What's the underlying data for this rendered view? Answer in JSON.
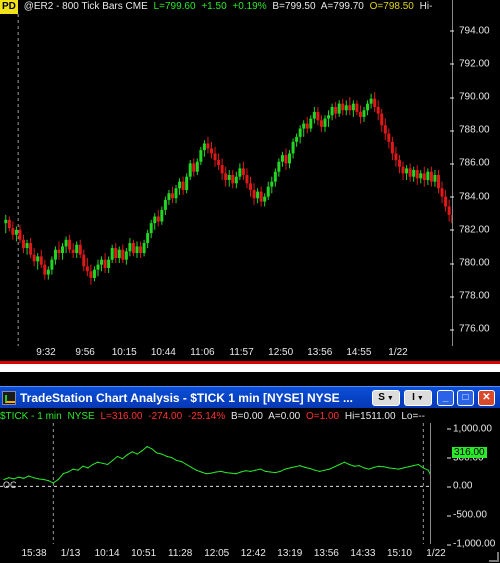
{
  "upper_chart": {
    "badge": "PD",
    "symbol_line": "@ER2 - 800 Tick Bars CME",
    "last": "L=799.60",
    "change": "+1.50",
    "pct_change": "+0.19%",
    "bid": "B=799.50",
    "ask": "A=799.70",
    "open": "O=798.50",
    "high": "Hi-",
    "colors": {
      "up_bar": "#23d623",
      "down_bar": "#e01818",
      "session_line": "#9a9a9a"
    }
  },
  "lower_window": {
    "title": "TradeStation Chart Analysis - $TICK 1 min [NYSE] NYSE ...",
    "symbol": "$TICK - 1 min",
    "exchange": "NYSE",
    "last": "L=316.00",
    "change": "-274.00",
    "pct_change": "-25.14%",
    "bid": "B=0.00",
    "ask": "A=0.00",
    "open": "O=1.00",
    "high": "Hi=1511.00",
    "low": "Lo=--",
    "last_value_marker": "316.00",
    "loc_label": "OC",
    "buttons": {
      "dropdown1": "S",
      "dropdown2": "I",
      "minimize": "_",
      "maximize": "□",
      "close": "✕"
    },
    "colors": {
      "line": "#2be82b",
      "zero_line": "#e0e0e0",
      "titlebar": "#0a4fd8"
    }
  },
  "chart_data": [
    {
      "type": "bar",
      "subtype": "ohlc",
      "title": "@ER2 - 800 Tick Bars CME",
      "xlabel": "",
      "ylabel": "",
      "ylim": [
        775,
        795
      ],
      "yticks": [
        "794.00",
        "792.00",
        "790.00",
        "788.00",
        "786.00",
        "784.00",
        "782.00",
        "780.00",
        "778.00",
        "776.00"
      ],
      "xticks": [
        "9:32",
        "9:56",
        "10:15",
        "10:44",
        "11:06",
        "11:57",
        "12:50",
        "13:56",
        "14:55",
        "1/22"
      ],
      "grid": false,
      "session_breaks": [
        4,
        127
      ],
      "bars": [
        [
          782.4,
          782.9,
          781.8,
          782.6
        ],
        [
          782.6,
          782.8,
          781.9,
          782.1
        ],
        [
          782.1,
          782.5,
          781.4,
          781.7
        ],
        [
          781.7,
          782.2,
          781.3,
          782.0
        ],
        [
          782.0,
          782.3,
          781.2,
          781.4
        ],
        [
          781.4,
          781.7,
          780.6,
          780.9
        ],
        [
          780.9,
          781.4,
          780.5,
          781.2
        ],
        [
          781.2,
          781.5,
          780.3,
          780.5
        ],
        [
          780.5,
          780.9,
          779.8,
          780.1
        ],
        [
          780.1,
          780.6,
          779.6,
          780.4
        ],
        [
          780.4,
          780.8,
          779.7,
          779.9
        ],
        [
          779.9,
          780.2,
          779.0,
          779.3
        ],
        [
          779.3,
          779.8,
          779.0,
          779.6
        ],
        [
          779.6,
          780.4,
          779.3,
          780.2
        ],
        [
          780.2,
          781.0,
          779.9,
          780.8
        ],
        [
          780.8,
          781.3,
          780.2,
          780.6
        ],
        [
          780.6,
          781.2,
          780.2,
          781.0
        ],
        [
          781.0,
          781.6,
          780.6,
          781.4
        ],
        [
          781.4,
          781.7,
          780.6,
          780.8
        ],
        [
          780.8,
          781.2,
          780.3,
          780.6
        ],
        [
          780.6,
          781.3,
          780.3,
          781.1
        ],
        [
          781.1,
          781.4,
          780.3,
          780.5
        ],
        [
          780.5,
          780.8,
          779.5,
          779.8
        ],
        [
          779.8,
          780.3,
          779.2,
          779.5
        ],
        [
          779.5,
          779.9,
          778.7,
          779.1
        ],
        [
          779.1,
          779.8,
          778.9,
          779.6
        ],
        [
          779.6,
          780.2,
          779.2,
          779.9
        ],
        [
          779.9,
          780.4,
          779.5,
          780.2
        ],
        [
          780.2,
          780.6,
          779.4,
          779.7
        ],
        [
          779.7,
          780.4,
          779.4,
          780.2
        ],
        [
          780.2,
          781.1,
          780.0,
          780.9
        ],
        [
          780.9,
          781.2,
          780.0,
          780.3
        ],
        [
          780.3,
          781.0,
          780.0,
          780.8
        ],
        [
          780.8,
          781.1,
          780.0,
          780.2
        ],
        [
          780.2,
          780.9,
          779.9,
          780.7
        ],
        [
          780.7,
          781.5,
          780.4,
          781.2
        ],
        [
          781.2,
          781.4,
          780.4,
          780.6
        ],
        [
          780.6,
          781.3,
          780.3,
          781.0
        ],
        [
          781.0,
          781.3,
          780.3,
          780.6
        ],
        [
          780.6,
          781.4,
          780.4,
          781.2
        ],
        [
          781.2,
          782.0,
          780.9,
          781.8
        ],
        [
          781.8,
          782.6,
          781.5,
          782.4
        ],
        [
          782.4,
          783.0,
          782.0,
          782.8
        ],
        [
          782.8,
          783.2,
          782.2,
          782.5
        ],
        [
          782.5,
          783.4,
          782.3,
          783.2
        ],
        [
          783.2,
          784.0,
          782.9,
          783.8
        ],
        [
          783.8,
          784.4,
          783.5,
          784.2
        ],
        [
          784.2,
          784.6,
          783.6,
          783.9
        ],
        [
          783.9,
          784.7,
          783.6,
          784.5
        ],
        [
          784.5,
          785.1,
          784.1,
          784.9
        ],
        [
          784.9,
          785.2,
          784.1,
          784.4
        ],
        [
          784.4,
          785.4,
          784.2,
          785.2
        ],
        [
          785.2,
          786.2,
          785.0,
          786.0
        ],
        [
          786.0,
          786.3,
          785.2,
          785.5
        ],
        [
          785.5,
          786.3,
          785.3,
          786.1
        ],
        [
          786.1,
          787.0,
          785.9,
          786.8
        ],
        [
          786.8,
          787.4,
          786.4,
          787.2
        ],
        [
          787.2,
          787.6,
          786.6,
          786.9
        ],
        [
          786.9,
          787.3,
          786.3,
          786.6
        ],
        [
          786.6,
          787.0,
          785.8,
          786.2
        ],
        [
          786.2,
          786.6,
          785.6,
          785.9
        ],
        [
          785.9,
          786.3,
          785.0,
          785.4
        ],
        [
          785.4,
          785.8,
          784.6,
          785.0
        ],
        [
          785.0,
          785.6,
          784.6,
          785.3
        ],
        [
          785.3,
          785.6,
          784.5,
          784.8
        ],
        [
          784.8,
          785.5,
          784.5,
          785.2
        ],
        [
          785.2,
          786.0,
          785.0,
          785.7
        ],
        [
          785.7,
          786.1,
          785.0,
          785.3
        ],
        [
          785.3,
          785.7,
          784.5,
          784.8
        ],
        [
          784.8,
          785.2,
          784.0,
          784.4
        ],
        [
          784.4,
          784.8,
          783.5,
          783.9
        ],
        [
          783.9,
          784.5,
          783.6,
          784.3
        ],
        [
          784.3,
          784.6,
          783.4,
          783.7
        ],
        [
          783.7,
          784.2,
          783.4,
          784.0
        ],
        [
          784.0,
          784.9,
          783.8,
          784.6
        ],
        [
          784.6,
          785.2,
          784.2,
          784.9
        ],
        [
          784.9,
          785.7,
          784.6,
          785.5
        ],
        [
          785.5,
          786.3,
          785.2,
          786.1
        ],
        [
          786.1,
          786.7,
          785.8,
          786.5
        ],
        [
          786.5,
          786.9,
          785.6,
          786.0
        ],
        [
          786.0,
          786.8,
          785.7,
          786.6
        ],
        [
          786.6,
          787.5,
          786.3,
          787.3
        ],
        [
          787.3,
          787.8,
          787.0,
          787.6
        ],
        [
          787.6,
          788.3,
          787.2,
          788.1
        ],
        [
          788.1,
          788.6,
          787.6,
          788.4
        ],
        [
          788.4,
          788.8,
          787.8,
          788.1
        ],
        [
          788.1,
          788.9,
          787.9,
          788.7
        ],
        [
          788.7,
          789.4,
          788.4,
          789.1
        ],
        [
          789.1,
          789.4,
          788.3,
          788.6
        ],
        [
          788.6,
          788.9,
          787.9,
          788.2
        ],
        [
          788.2,
          788.9,
          787.9,
          788.7
        ],
        [
          788.7,
          789.2,
          788.2,
          788.9
        ],
        [
          788.9,
          789.6,
          788.6,
          789.4
        ],
        [
          789.4,
          789.7,
          788.7,
          789.0
        ],
        [
          789.0,
          789.8,
          788.8,
          789.6
        ],
        [
          789.6,
          789.9,
          788.9,
          789.2
        ],
        [
          789.2,
          789.8,
          788.9,
          789.5
        ],
        [
          789.5,
          790.0,
          788.9,
          789.2
        ],
        [
          789.2,
          789.8,
          788.8,
          789.6
        ],
        [
          789.6,
          789.8,
          788.9,
          789.1
        ],
        [
          789.1,
          789.5,
          788.4,
          788.8
        ],
        [
          788.8,
          789.4,
          788.5,
          789.2
        ],
        [
          789.2,
          789.8,
          788.9,
          789.6
        ],
        [
          789.6,
          790.2,
          789.3,
          789.9
        ],
        [
          789.9,
          790.3,
          789.1,
          789.4
        ],
        [
          789.4,
          789.8,
          788.6,
          789.0
        ],
        [
          789.0,
          789.3,
          787.9,
          788.3
        ],
        [
          788.3,
          788.7,
          787.4,
          787.8
        ],
        [
          787.8,
          788.1,
          786.9,
          787.3
        ],
        [
          787.3,
          787.6,
          786.2,
          786.6
        ],
        [
          786.6,
          787.0,
          785.8,
          786.2
        ],
        [
          786.2,
          786.5,
          785.4,
          785.8
        ],
        [
          785.8,
          786.1,
          785.0,
          785.4
        ],
        [
          785.4,
          785.9,
          785.0,
          785.7
        ],
        [
          785.7,
          786.0,
          784.9,
          785.2
        ],
        [
          785.2,
          785.8,
          784.9,
          785.6
        ],
        [
          785.6,
          785.9,
          784.7,
          785.1
        ],
        [
          785.1,
          785.6,
          784.8,
          785.4
        ],
        [
          785.4,
          785.8,
          784.6,
          785.0
        ],
        [
          785.0,
          785.7,
          784.7,
          785.5
        ],
        [
          785.5,
          785.8,
          784.6,
          784.9
        ],
        [
          784.9,
          785.6,
          784.6,
          785.3
        ],
        [
          785.3,
          785.6,
          784.2,
          784.5
        ],
        [
          784.5,
          784.9,
          783.6,
          784.0
        ],
        [
          784.0,
          784.4,
          783.1,
          783.4
        ],
        [
          783.4,
          783.8,
          782.5,
          782.9
        ],
        [
          782.9,
          783.3,
          782.0,
          782.4
        ],
        [
          782.4,
          782.8,
          781.6,
          782.0
        ]
      ]
    },
    {
      "type": "line",
      "title": "$TICK - 1 min",
      "xlabel": "",
      "ylabel": "",
      "ylim": [
        -1000,
        1100
      ],
      "yticks": [
        "1,000.00",
        "500.00",
        "0.00",
        "-500.00",
        "-1,000.00"
      ],
      "xticks": [
        "15:38",
        "1/13",
        "10:14",
        "10:51",
        "11:28",
        "12:05",
        "12:42",
        "13:19",
        "13:56",
        "14:33",
        "15:10",
        "1/22"
      ],
      "grid": false,
      "session_breaks": [
        10,
        85
      ],
      "series": [
        {
          "values": [
            120,
            150,
            130,
            160,
            140,
            180,
            150,
            130,
            120,
            100,
            60,
            120,
            220,
            250,
            300,
            280,
            350,
            320,
            380,
            420,
            400,
            380,
            450,
            520,
            480,
            550,
            600,
            560,
            620,
            690,
            650,
            580,
            560,
            520,
            500,
            450,
            430,
            380,
            330,
            280,
            250,
            220,
            230,
            250,
            260,
            240,
            230,
            220,
            250,
            270,
            260,
            280,
            300,
            260,
            250,
            240,
            260,
            300,
            320,
            340,
            360,
            330,
            310,
            280,
            260,
            280,
            300,
            340,
            380,
            420,
            380,
            350,
            360,
            320,
            300,
            330,
            350,
            340,
            320,
            310,
            300,
            320,
            340,
            360,
            380,
            320,
            280,
            100,
            -150,
            -30,
            316
          ]
        }
      ]
    }
  ]
}
